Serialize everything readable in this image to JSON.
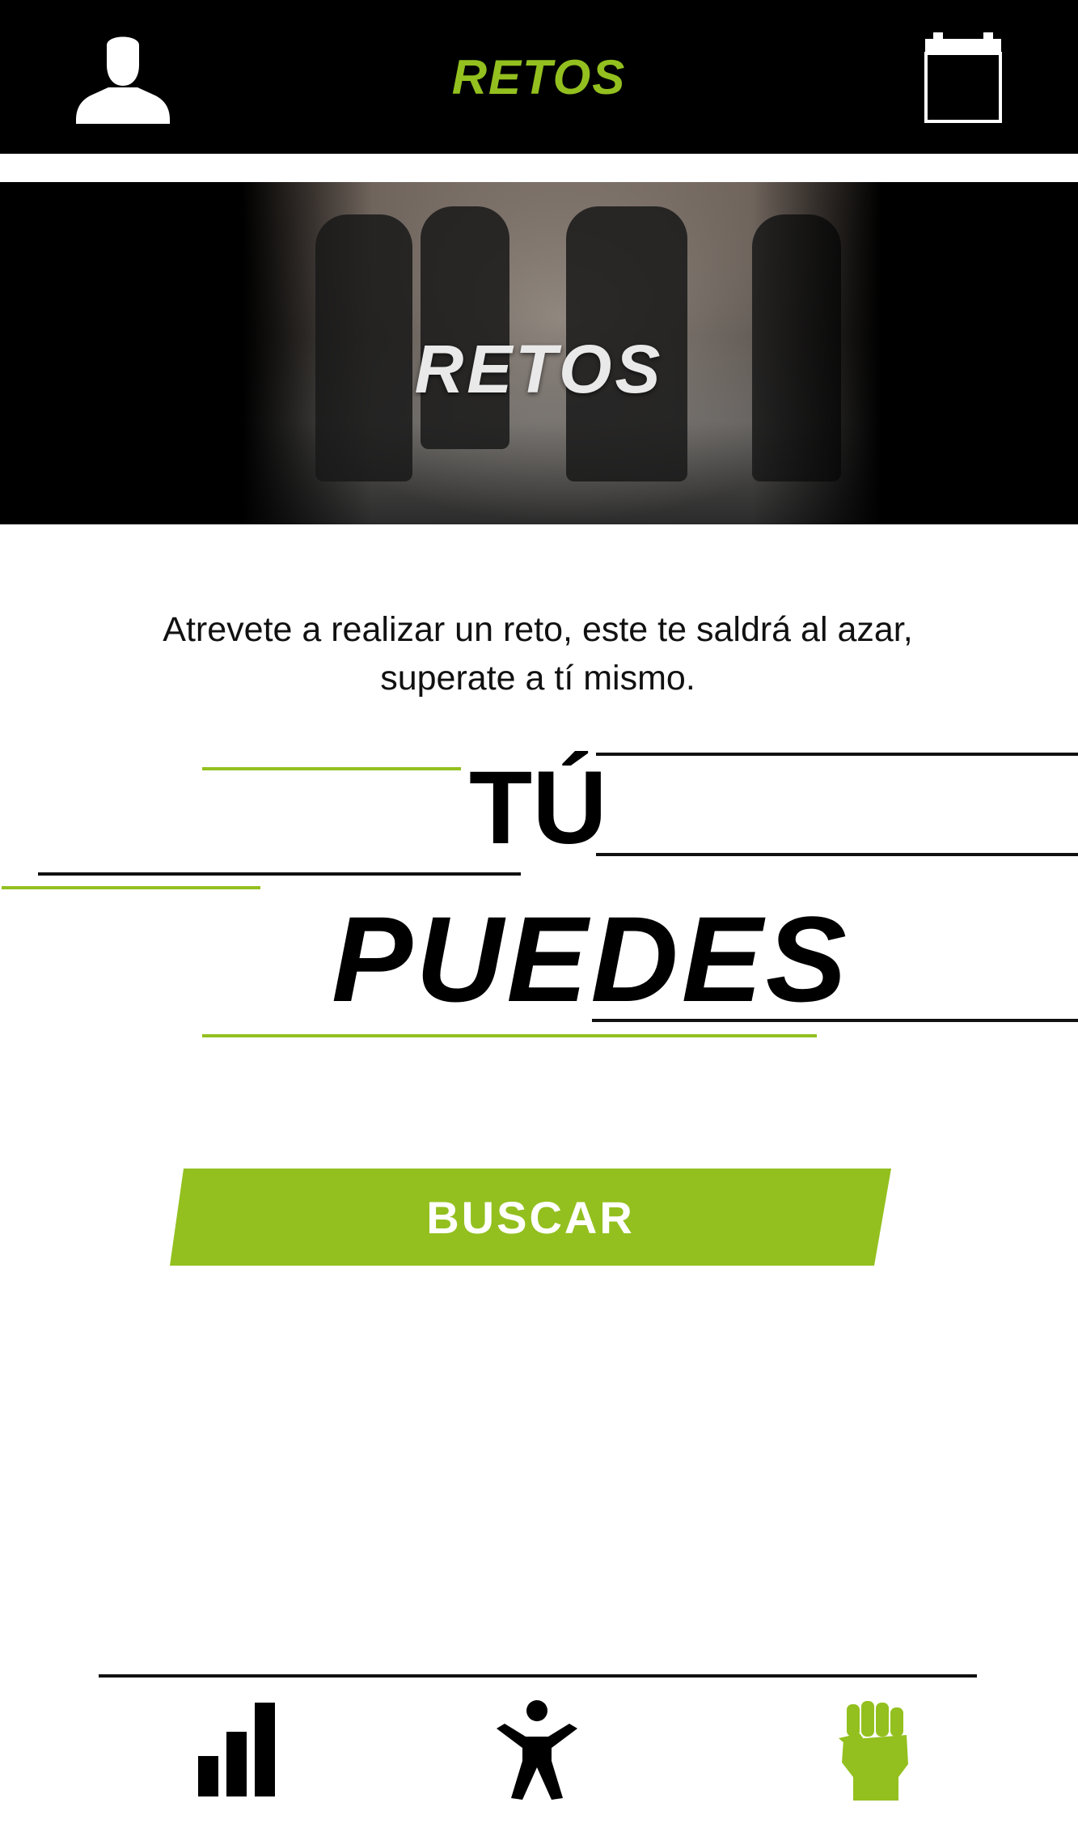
{
  "header": {
    "title": "RETOS",
    "profile_icon": "user-icon",
    "calendar_icon": "calendar-icon"
  },
  "hero": {
    "title": "RETOS"
  },
  "intro": {
    "line1": "Atrevete a realizar un reto, este te saldrá al azar,",
    "line2": "superate a tí mismo."
  },
  "slogan": {
    "line1": "TÚ",
    "line2": "PUEDES"
  },
  "search_button": {
    "label": "BUSCAR"
  },
  "bottom_nav": {
    "items": [
      {
        "icon": "bar-chart-icon",
        "active": false
      },
      {
        "icon": "person-exercise-icon",
        "active": false
      },
      {
        "icon": "fist-icon",
        "active": true
      }
    ]
  },
  "colors": {
    "accent": "#93c01f",
    "header_bg": "#000000",
    "text": "#111111"
  }
}
